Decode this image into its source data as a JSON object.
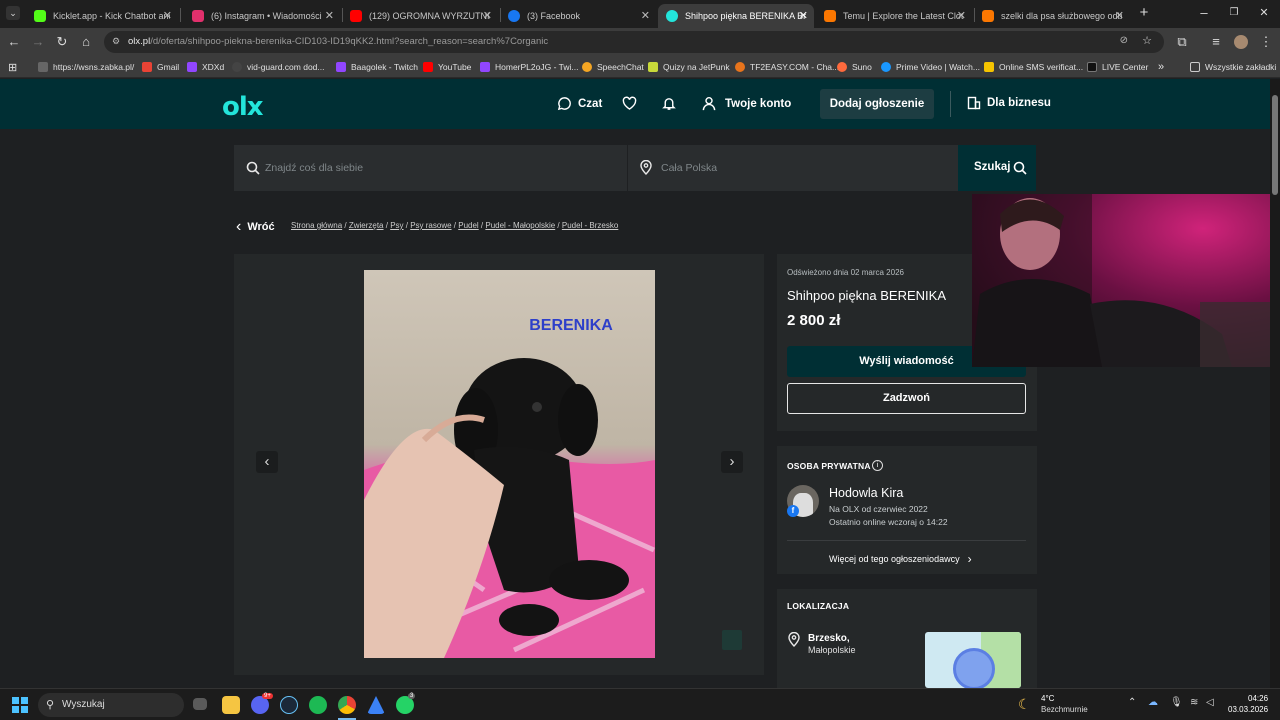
{
  "browser": {
    "tabs": [
      {
        "title": "Kicklet.app - Kick Chatbot and",
        "color": "#53fc18"
      },
      {
        "title": "(6) Instagram • Wiadomości",
        "color": "#e1306c"
      },
      {
        "title": "(129) OGROMNA WYRZUTNIA",
        "color": "#ff0000"
      },
      {
        "title": "(3) Facebook",
        "color": "#1877f2"
      },
      {
        "title": "Shihpoo piękna BERENIKA Brze",
        "color": "#23e5db"
      },
      {
        "title": "Temu | Explore the Latest Cloth",
        "color": "#fb7701"
      },
      {
        "title": "szelki dla psa służbowego odbl",
        "color": "#fb7701"
      }
    ],
    "url_main": "olx.pl",
    "url_rest": "/d/oferta/shihpoo-piekna-berenika-CID103-ID19qKK2.html?search_reason=search%7Corganic",
    "bookmarks": [
      "https://wsns.zabka.pl/",
      "Gmail",
      "XDXd",
      "vid-guard.com dod...",
      "Baagolek - Twitch",
      "YouTube",
      "HomerPL2oJG - Twi...",
      "SpeechChat",
      "Quizy na JetPunk",
      "TF2EASY.COM - Cha...",
      "Suno",
      "Prime Video | Watch...",
      "Online SMS verificat...",
      "LIVE Center"
    ],
    "bookmarks_more": "»",
    "bookmarks_folder": "Wszystkie zakładki"
  },
  "olx": {
    "logo": "olx",
    "header": {
      "chat": "Czat",
      "account": "Twoje konto",
      "add": "Dodaj ogłoszenie",
      "business": "Dla biznesu"
    },
    "search": {
      "placeholder": "Znajdź coś dla siebie",
      "location_placeholder": "Cała Polska",
      "button": "Szukaj"
    },
    "back": "Wróć",
    "breadcrumbs": [
      "Strona główna",
      "Zwierzęta",
      "Psy",
      "Psy rasowe",
      "Pudel",
      "Pudel - Małopolskie",
      "Pudel - Brzesko"
    ],
    "photo_caption": "BERENIKA",
    "offer": {
      "refreshed": "Odświeżono dnia 02 marca 2026",
      "title": "Shihpoo piękna BERENIKA",
      "price": "2 800 zł",
      "message_btn": "Wyślij wiadomość",
      "call_btn": "Zadzwoń"
    },
    "seller": {
      "type": "OSOBA PRYWATNA",
      "name": "Hodowla Kira",
      "since": "Na OLX od czerwiec 2022",
      "online": "Ostatnio online wczoraj o 14:22",
      "more": "Więcej od tego ogłoszeniodawcy"
    },
    "location": {
      "header": "LOKALIZACJA",
      "city": "Brzesko,",
      "region": "Małopolskie"
    }
  },
  "taskbar": {
    "search": "Wyszukaj",
    "weather_temp": "4°C",
    "weather_desc": "Bezchmurnie",
    "time": "04:26",
    "date": "03.03.2026",
    "discord_badge": "9+",
    "whatsapp_badge": "3"
  }
}
